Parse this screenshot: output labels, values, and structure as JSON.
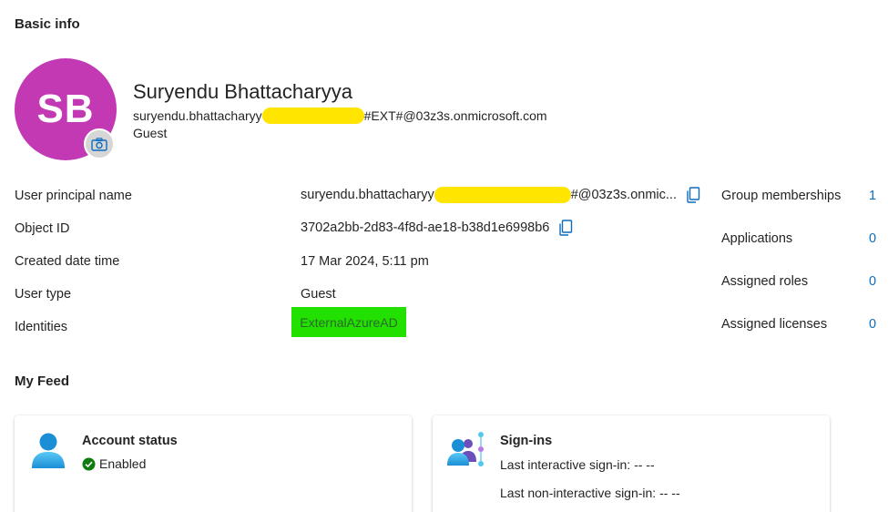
{
  "basic_info": {
    "section_title": "Basic info",
    "avatar_initials": "SB",
    "avatar_color": "#c239b3",
    "camera_icon": "camera-icon",
    "display_name": "Suryendu Bhattacharyya",
    "email_prefix": "suryendu.bhattacharyy",
    "email_suffix": "#EXT#@03z3s.onmicrosoft.com",
    "user_type_line": "Guest"
  },
  "properties": [
    {
      "label": "User principal name",
      "value_prefix": "suryendu.bhattacharyy",
      "value_suffix": "#@03z3s.onmic..."
    },
    {
      "label": "Object ID",
      "value": "3702a2bb-2d83-4f8d-ae18-b38d1e6998b6"
    },
    {
      "label": "Created date time",
      "value": "17 Mar 2024, 5:11 pm"
    },
    {
      "label": "User type",
      "value": "Guest"
    },
    {
      "label": "Identities",
      "value": "ExternalAzureAD"
    }
  ],
  "stats": [
    {
      "label": "Group memberships",
      "value": "1"
    },
    {
      "label": "Applications",
      "value": "0"
    },
    {
      "label": "Assigned roles",
      "value": "0"
    },
    {
      "label": "Assigned licenses",
      "value": "0"
    }
  ],
  "feed": {
    "section_title": "My Feed",
    "account_status": {
      "title": "Account status",
      "status": "Enabled",
      "status_color": "#107c10",
      "icon": "user-icon"
    },
    "sign_ins": {
      "title": "Sign-ins",
      "last_interactive": "Last interactive sign-in: -- --",
      "last_non_interactive": "Last non-interactive sign-in: -- --",
      "icon": "sign-in-users-icon"
    }
  },
  "colors": {
    "link": "#0f6cbd",
    "redaction": "#ffe500",
    "identity_highlight": "#22e000"
  }
}
